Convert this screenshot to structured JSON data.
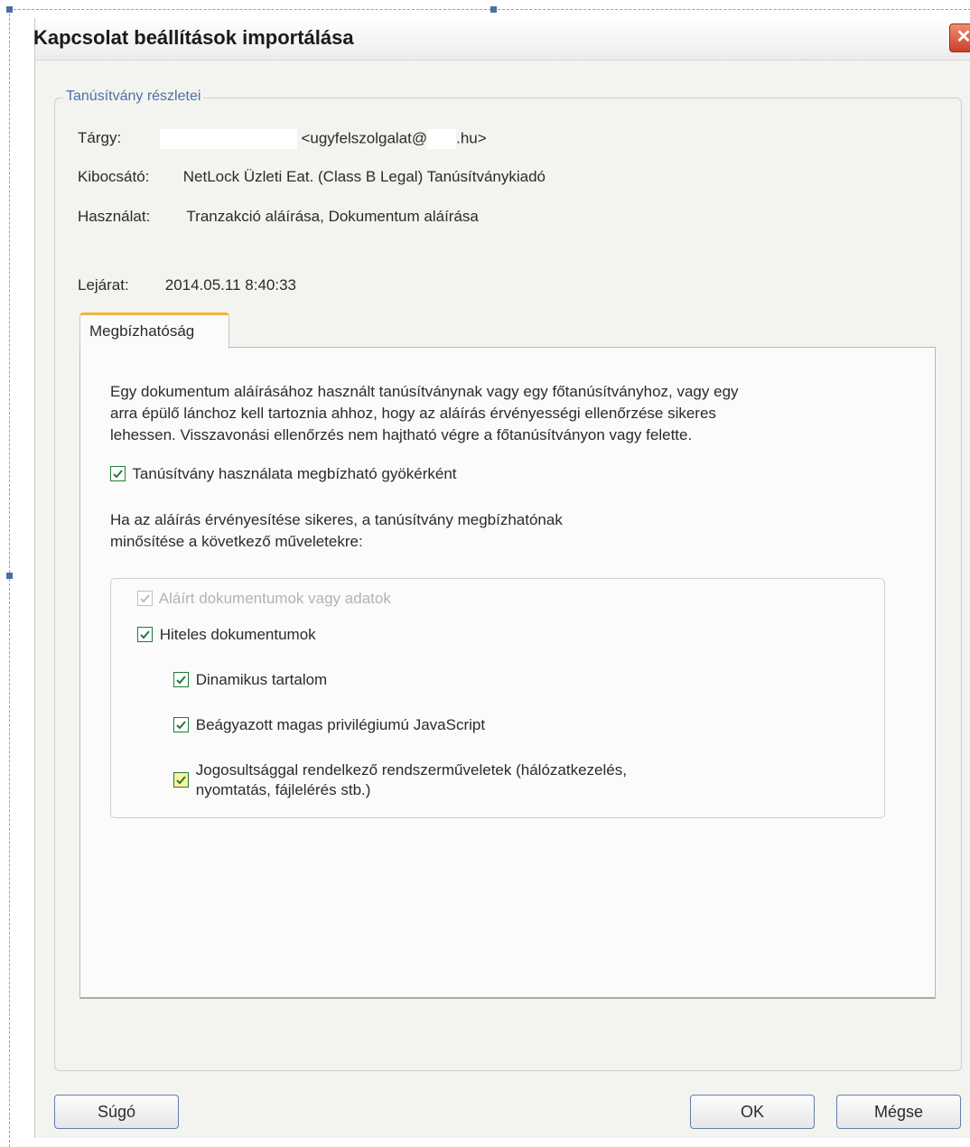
{
  "dialog": {
    "title": "Kapcsolat beállítások importálása",
    "close_glyph": "✕"
  },
  "details": {
    "legend": "Tanúsítvány részletei",
    "subject_label": "Tárgy:",
    "subject_value_prefix": "<ugyfelszolgalat@",
    "subject_value_suffix": ".hu>",
    "issuer_label": "Kibocsátó:",
    "issuer_value": "NetLock Üzleti Eat. (Class B Legal) Tanúsítványkiadó",
    "usage_label": "Használat:",
    "usage_value": "Tranzakció aláírása, Dokumentum aláírása",
    "expiry_label": "Lejárat:",
    "expiry_value": "2014.05.11 8:40:33"
  },
  "trust_tab": {
    "label": "Megbízhatóság",
    "description_lines": [
      "Egy dokumentum aláírásához használt tanúsítványnak vagy egy főtanúsítványhoz, vagy egy",
      "arra épülő lánchoz kell tartoznia ahhoz, hogy az aláírás érvényességi ellenőrzése sikeres",
      "lehessen. Visszavonási ellenőrzés nem hajtható végre a főtanúsítványon vagy felette."
    ],
    "use_as_root": {
      "label": "Tanúsítvány használata megbízható gyökérként",
      "checked": true
    },
    "trust_intro_lines": [
      "Ha az aláírás érvényesítése sikeres, a tanúsítvány megbízhatónak",
      "minősítése a következő műveletekre:"
    ],
    "options": [
      {
        "label": "Aláírt dokumentumok vagy adatok",
        "checked": true,
        "disabled": true
      },
      {
        "label": "Hiteles dokumentumok",
        "checked": true,
        "disabled": false
      },
      {
        "label": "Dinamikus tartalom",
        "checked": true,
        "disabled": false
      },
      {
        "label": "Beágyazott magas privilégiumú JavaScript",
        "checked": true,
        "disabled": false
      },
      {
        "label_lines": [
          "Jogosultsággal rendelkező rendszerműveletek (hálózatkezelés,",
          "nyomtatás, fájlelérés stb.)"
        ],
        "checked": true,
        "disabled": false
      }
    ]
  },
  "buttons": {
    "help": "Súgó",
    "ok": "OK",
    "cancel": "Mégse"
  },
  "colors": {
    "legend": "#4b6fa8",
    "tab_accent": "#f1b540",
    "check": "#1f7a3a",
    "close_button": "#c9412a"
  }
}
